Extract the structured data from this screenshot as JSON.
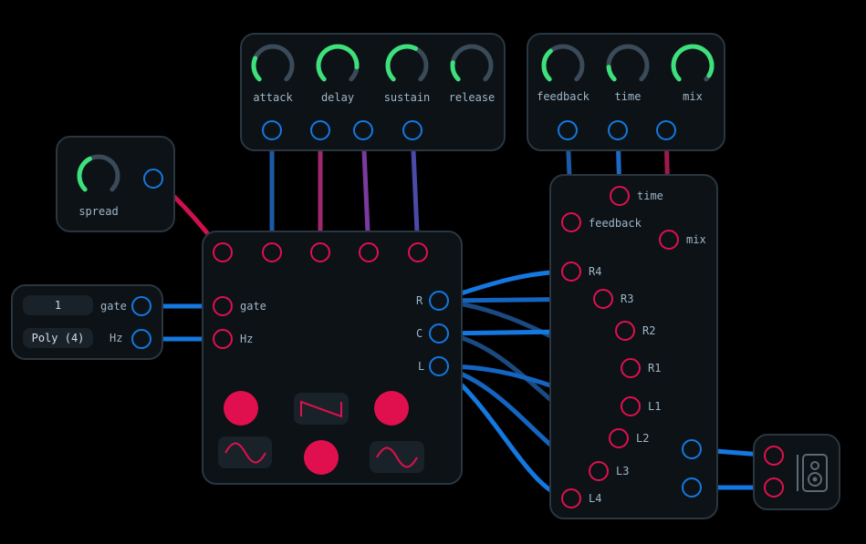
{
  "envelope": {
    "knobs": [
      {
        "label": "attack",
        "value": 0.25
      },
      {
        "label": "delay",
        "value": 0.85
      },
      {
        "label": "sustain",
        "value": 0.6
      },
      {
        "label": "release",
        "value": 0.2
      }
    ]
  },
  "delay_fx": {
    "knobs": [
      {
        "label": "feedback",
        "value": 0.35
      },
      {
        "label": "time",
        "value": 0.15
      },
      {
        "label": "mix",
        "value": 0.95
      }
    ]
  },
  "spread_module": {
    "label": "spread",
    "value": 0.4
  },
  "midi": {
    "channel_value": "1",
    "poly_value": "Poly (4)",
    "gate_label": "gate",
    "hz_label": "Hz"
  },
  "synth": {
    "in_gate_label": "gate",
    "in_hz_label": "Hz",
    "out_labels": {
      "r": "R",
      "c": "C",
      "l": "L"
    }
  },
  "mixer": {
    "time_label": "time",
    "feedback_label": "feedback",
    "mix_label": "mix",
    "inputs": [
      "R4",
      "R3",
      "R2",
      "R1",
      "L1",
      "L2",
      "L3",
      "L4"
    ]
  },
  "colors": {
    "panel": "#0c1216",
    "border": "#2a3640",
    "input_port": "#e0104e",
    "output_port": "#1478e0",
    "knob_active": "#3de07a",
    "knob_track": "#3a4a58"
  },
  "icons": {
    "speaker": "speaker-icon",
    "saw": "saw-wave-icon",
    "sine": "sine-wave-icon"
  }
}
